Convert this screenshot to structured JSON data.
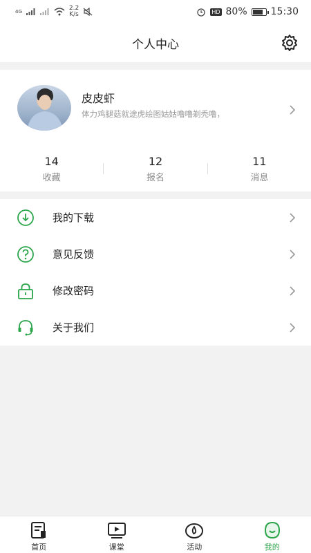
{
  "status_bar": {
    "network": "4G",
    "speed_top": "2.2",
    "speed_bottom": "K/s",
    "battery": "80%",
    "time": "15:30",
    "hd": "HD"
  },
  "header": {
    "title": "个人中心"
  },
  "profile": {
    "name": "皮皮虾",
    "bio": "体力鸡腿菇就途虎绘图姑姑噜噜剃秃噜，"
  },
  "stats": [
    {
      "value": "14",
      "label": "收藏"
    },
    {
      "value": "12",
      "label": "报名"
    },
    {
      "value": "11",
      "label": "消息"
    }
  ],
  "menu": [
    {
      "label": "我的下载",
      "icon": "download-icon"
    },
    {
      "label": "意见反馈",
      "icon": "question-icon"
    },
    {
      "label": "修改密码",
      "icon": "lock-icon"
    },
    {
      "label": "关于我们",
      "icon": "headset-icon"
    }
  ],
  "tabs": [
    {
      "label": "首页",
      "icon": "home-icon"
    },
    {
      "label": "课堂",
      "icon": "video-icon"
    },
    {
      "label": "活动",
      "icon": "activity-icon"
    },
    {
      "label": "我的",
      "icon": "profile-icon",
      "active": true
    }
  ],
  "colors": {
    "accent": "#2aa54a"
  }
}
